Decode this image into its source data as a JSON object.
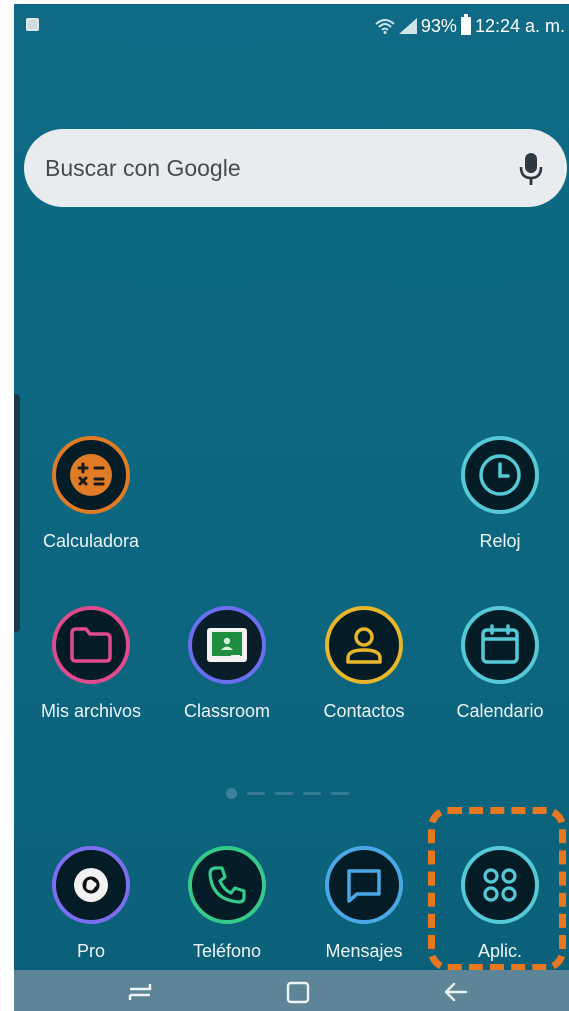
{
  "status_bar": {
    "battery": "93%",
    "time": "12:24 a. m."
  },
  "search": {
    "placeholder": "Buscar con Google"
  },
  "apps": [
    {
      "label": "Calculadora",
      "icon": "calculator-icon",
      "ring": "#e07b26"
    },
    {
      "label": "Reloj",
      "icon": "clock-icon",
      "ring": "#55c9d6"
    },
    {
      "label": "Mis archivos",
      "icon": "folder-icon",
      "ring": "#e04a8f"
    },
    {
      "label": "Classroom",
      "icon": "classroom-icon",
      "ring": "#6a6ff0"
    },
    {
      "label": "Contactos",
      "icon": "contacts-icon",
      "ring": "#e8b62b"
    },
    {
      "label": "Calendario",
      "icon": "calendar-icon",
      "ring": "#55c9d6"
    }
  ],
  "dock": [
    {
      "label": "Pro",
      "icon": "camera-icon",
      "ring": "#7b6ff0"
    },
    {
      "label": "Teléfono",
      "icon": "phone-icon",
      "ring": "#35c98a"
    },
    {
      "label": "Mensajes",
      "icon": "messages-icon",
      "ring": "#4aa8e6"
    },
    {
      "label": "Aplic.",
      "icon": "apps-grid-icon",
      "ring": "#55c9d6"
    }
  ],
  "colors": {
    "highlight": "#e87722",
    "wallpaper": "#0f6b85"
  }
}
